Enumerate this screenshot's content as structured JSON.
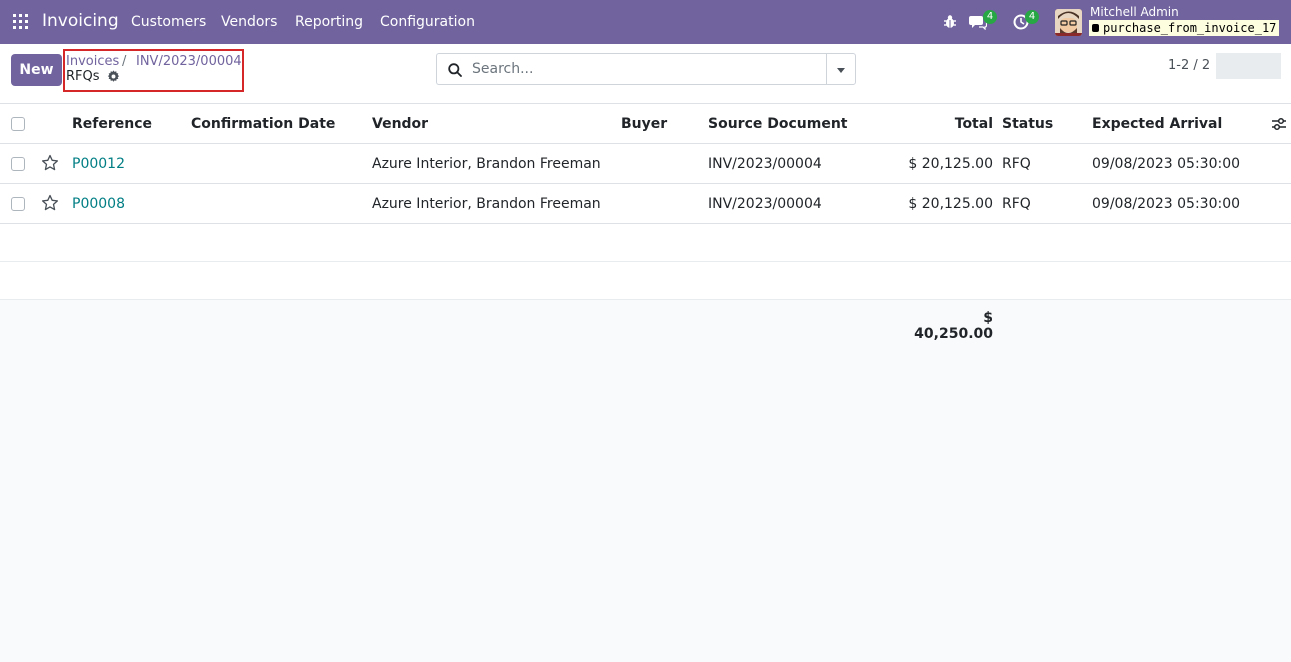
{
  "navbar": {
    "brand": "Invoicing",
    "menu": [
      "Customers",
      "Vendors",
      "Reporting",
      "Configuration"
    ],
    "messages_count": "4",
    "activities_count": "4",
    "user_name": "Mitchell Admin",
    "database": "purchase_from_invoice_17"
  },
  "control_panel": {
    "new_label": "New",
    "breadcrumb": [
      "Invoices",
      "INV/2023/00004"
    ],
    "breadcrumb_separator": "/",
    "current_view": "RFQs",
    "search_placeholder": "Search...",
    "pager": "1-2 / 2"
  },
  "table": {
    "headers": {
      "reference": "Reference",
      "confirmation_date": "Confirmation Date",
      "vendor": "Vendor",
      "buyer": "Buyer",
      "source_document": "Source Document",
      "total": "Total",
      "status": "Status",
      "expected_arrival": "Expected Arrival"
    },
    "rows": [
      {
        "reference": "P00012",
        "confirmation_date": "",
        "vendor": "Azure Interior, Brandon Freeman",
        "buyer": "",
        "source_document": "INV/2023/00004",
        "total": "$ 20,125.00",
        "status": "RFQ",
        "expected_arrival": "09/08/2023 05:30:00"
      },
      {
        "reference": "P00008",
        "confirmation_date": "",
        "vendor": "Azure Interior, Brandon Freeman",
        "buyer": "",
        "source_document": "INV/2023/00004",
        "total": "$ 20,125.00",
        "status": "RFQ",
        "expected_arrival": "09/08/2023 05:30:00"
      }
    ],
    "grand_total": "$ 40,250.00"
  },
  "colors": {
    "brand": "#71639e",
    "link": "#017e84",
    "badge": "#28a745",
    "highlight_border": "#d62728"
  }
}
